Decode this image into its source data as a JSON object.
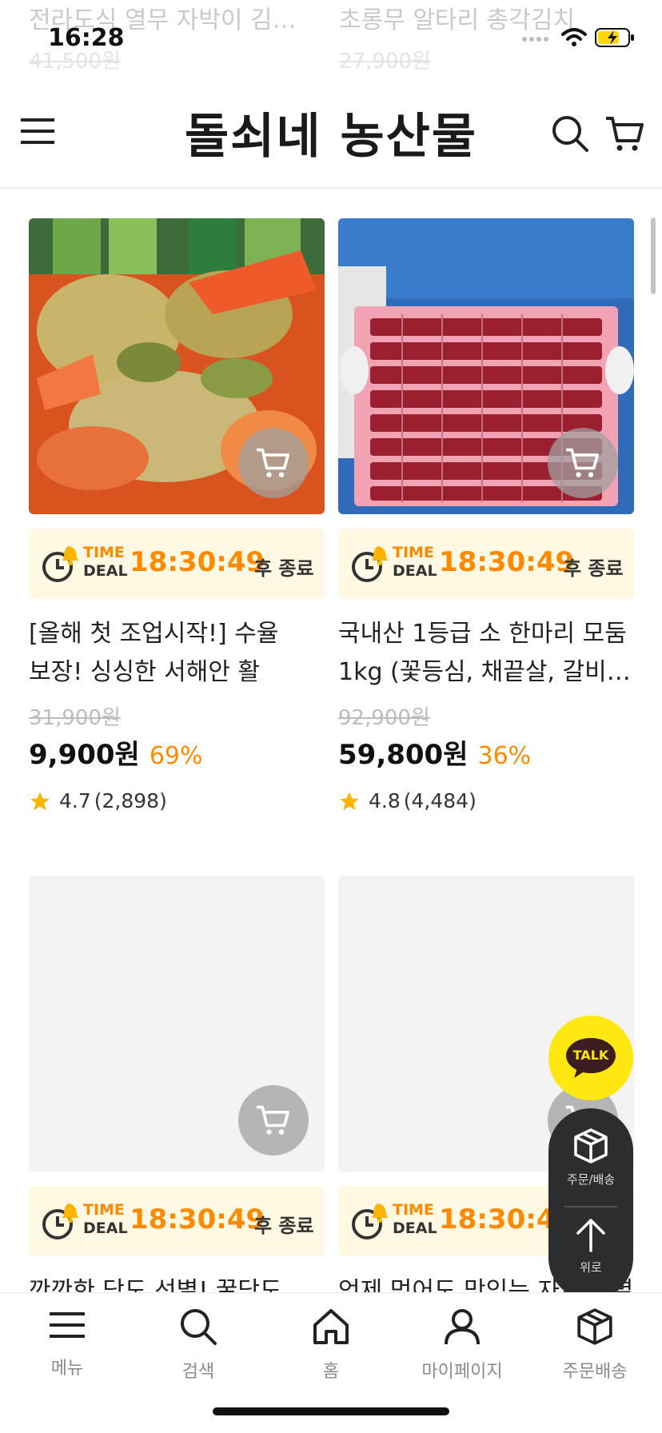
{
  "status_bar": {
    "time": "16:28"
  },
  "bleed": {
    "left_title": "전라도식 열무 자박이 김…",
    "left_price": "41,500원",
    "right_title": "초롱무 알타리 총각김치",
    "right_price": "27,900원"
  },
  "header": {
    "title": "돌쇠네 농산물",
    "menu_icon": "hamburger-icon",
    "search_icon": "search-icon",
    "cart_icon": "cart-icon"
  },
  "time_deal": {
    "time_word": "TIME",
    "deal_word": "DEAL",
    "countdown": "18:30:49",
    "suffix": "후 종료"
  },
  "products": [
    {
      "name": "[올해 첫 조업시작!] 수율 보장! 싱싱한 서해안 활 숫꽃…",
      "original_price": "31,900원",
      "price": "9,900원",
      "discount": "69%",
      "rating": "4.7",
      "reviews": "(2,898)"
    },
    {
      "name": "국내산 1등급 소 한마리 모둠 1kg (꽃등심, 채끝살, 갈비…",
      "original_price": "92,900원",
      "price": "59,800원",
      "discount": "36%",
      "rating": "4.8",
      "reviews": "(4,484)"
    },
    {
      "name": "깐깐한 당도 선별! 꿀당도 제철 햇 홍로사과 정품"
    },
    {
      "name": "언제 먹어도 맛있는 자체 선별 다금한 한국 꿀고구마"
    }
  ],
  "floating": {
    "talk_label": "TALK",
    "order_label": "주문/배송",
    "top_label": "위로"
  },
  "bottom_nav": [
    {
      "label": "메뉴",
      "icon": "menu-icon"
    },
    {
      "label": "검색",
      "icon": "search-icon"
    },
    {
      "label": "홈",
      "icon": "home-icon"
    },
    {
      "label": "마이페이지",
      "icon": "user-icon"
    },
    {
      "label": "주문배송",
      "icon": "box-icon"
    }
  ],
  "colors": {
    "accent": "#ff8a00",
    "deal_bg": "#fff8e2",
    "talk": "#ffe812",
    "star": "#ffb400"
  }
}
